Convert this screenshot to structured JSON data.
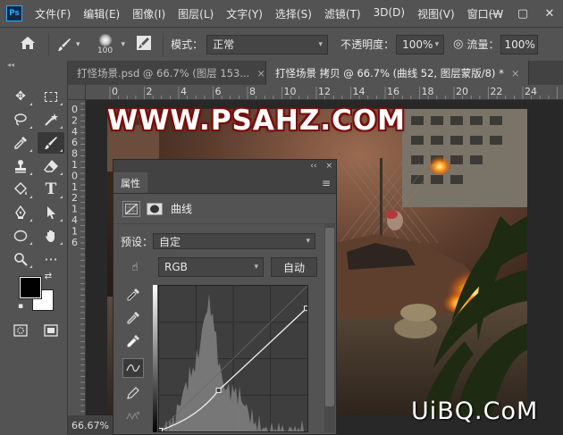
{
  "app": {
    "logo": "Ps",
    "menus": [
      "文件(F)",
      "编辑(E)",
      "图像(I)",
      "图层(L)",
      "文字(Y)",
      "选择(S)",
      "滤镜(T)",
      "3D(D)",
      "视图(V)",
      "窗口(W"
    ],
    "window_controls": [
      "—",
      "▢",
      "✕"
    ]
  },
  "options": {
    "brush_size": "100",
    "mode_label": "模式：",
    "mode_value": "正常",
    "opacity_label": "不透明度：",
    "opacity_value": "100%",
    "flow_label": "流量：",
    "flow_value": "100%"
  },
  "tabs": [
    {
      "label": "打怪场景.psd @ 66.7% (图层 153..."
    },
    {
      "label": "打怪场景 拷贝 @ 66.7% (曲线 52, 图层蒙版/8) *"
    }
  ],
  "tab_close": "×",
  "ruler": {
    "top_labels": [
      "0",
      "2",
      "4",
      "6",
      "8",
      "10",
      "12",
      "14",
      "16",
      "18",
      "20",
      "22",
      "24"
    ],
    "left_labels": [
      "0",
      "2",
      "4",
      "6",
      "8",
      "1",
      "0",
      "1",
      "2",
      "1",
      "4",
      "1",
      "6"
    ]
  },
  "canvas": {
    "watermark": "WWW.PSAHZ.COM"
  },
  "status": {
    "zoom": "66.67%"
  },
  "site_mark": "UiBQ.CoM",
  "properties": {
    "tab_label": "属性",
    "panel_controls": [
      "‹‹",
      "×"
    ],
    "menu_icon": "≡",
    "adjustment_title": "曲线",
    "preset_label": "预设：",
    "preset_value": "自定",
    "channel_value": "RGB",
    "auto_label": "自动"
  },
  "colors": {
    "ui_panel": "#535353",
    "ui_dark": "#424242",
    "accent": "#31a8ff",
    "watermark_stroke": "#7a0d0d"
  },
  "curve": {
    "points": [
      [
        0,
        0
      ],
      [
        0.4,
        0.28
      ],
      [
        1,
        0.85
      ]
    ]
  }
}
